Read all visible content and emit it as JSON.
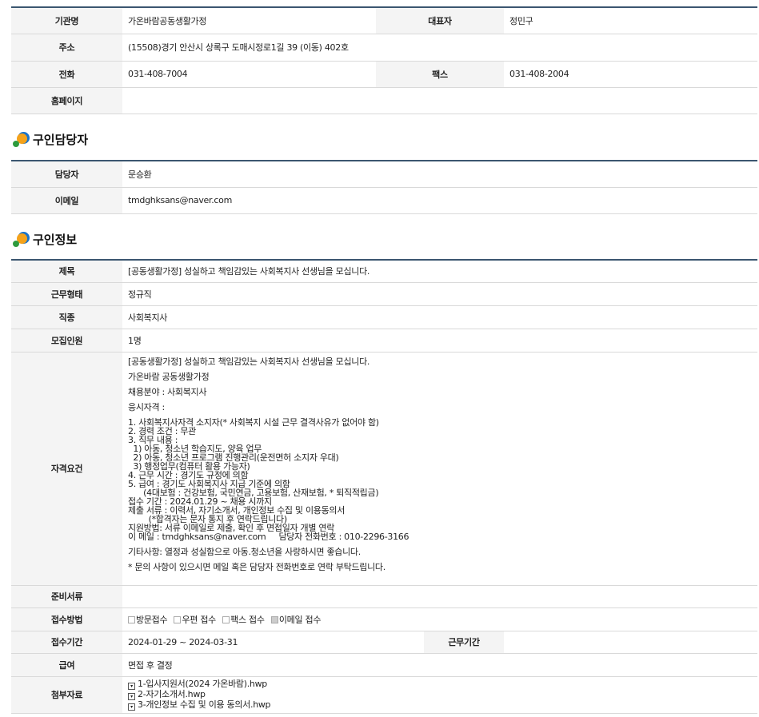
{
  "org": {
    "name_label": "기관명",
    "name": "가온바람공동생활가정",
    "rep_label": "대표자",
    "rep": "정민구",
    "address_label": "주소",
    "address": "(15508)경기 안산시 상록구 도매시정로1길 39 (이동) 402호",
    "phone_label": "전화",
    "phone": "031-408-7004",
    "fax_label": "팩스",
    "fax": "031-408-2004",
    "homepage_label": "홈페이지",
    "homepage": ""
  },
  "contact": {
    "section_title": "구인담당자",
    "manager_label": "담당자",
    "manager": "문승환",
    "email_label": "이메일",
    "email": "tmdghksans@naver.com"
  },
  "job": {
    "section_title": "구인정보",
    "title_label": "제목",
    "title": "[공동생활가정] 성실하고 책임감있는 사회복지사 선생님을 모십니다.",
    "worktype_label": "근무형태",
    "worktype": "정규직",
    "occupation_label": "직종",
    "occupation": "사회복지사",
    "headcount_label": "모집인원",
    "headcount": "1명",
    "qual_label": "자격요건",
    "qual_lines": {
      "l1": "[공동생활가정] 성실하고 책임감있는 사회복지사 선생님을 모십니다.",
      "l2": "가온바람 공동생활가정",
      "l3": "채용분야 : 사회복지사",
      "l4": "응시자격 :",
      "l5": "1. 사회복지사자격 소지자(* 사회복지 시설 근무 결격사유가 없어야 함)",
      "l6": "2. 경력 조건 : 무관",
      "l7": "3. 직무 내용 :",
      "l8": "  1) 아동, 청소년 학습지도, 양육 업무",
      "l9": "  2) 아동, 청소년 프로그램 진행관리(운전면허 소지자 우대)",
      "l10": "  3) 행정업무(컴퓨터 활용 가능자)",
      "l11": "4. 근무 시간 : 경기도 규정에 의함",
      "l12": "5. 급여 : 경기도 사회복지사 지급 기준에 의함",
      "l13": "      (4대보험 : 건강보험, 국민연금, 고용보험, 산재보험, * 퇴직적립금)",
      "l14": "접수 기간 : 2024.01.29 ~ 채용 시까지",
      "l15": "제출 서류 : 이력서, 자기소개서, 개인정보 수집 및 이용동의서",
      "l16": "        (*합격자는 문자 통지 후 연락드립니다)",
      "l17": "지원방법: 서류 이메일로 제출, 확인 후 면접일자 개별 연락",
      "l18": "이 메일 : tmdghksans@naver.com     담당자 전화번호 : 010-2296-3166",
      "l19": "기타사항: 열정과 성실함으로 아동.청소년을 사랑하시면 좋습니다.",
      "l20": "* 문의 사항이 있으시면 메일 혹은 담당자 전화번호로 연락 부탁드립니다."
    },
    "docs_label": "준비서류",
    "docs": "",
    "method_label": "접수방법",
    "methods": [
      {
        "label": "방문접수",
        "checked": false
      },
      {
        "label": "우편 접수",
        "checked": false
      },
      {
        "label": "팩스 접수",
        "checked": false
      },
      {
        "label": "이메일 접수",
        "checked": true
      }
    ],
    "period_label": "접수기간",
    "period": "2024-01-29 ~ 2024-03-31",
    "workperiod_label": "근무기간",
    "workperiod": "",
    "salary_label": "급여",
    "salary": "면접 후 결정",
    "attach_label": "첨부자료",
    "attachments": [
      "1-입사지원서(2024 가온바람).hwp",
      "2-자기소개서.hwp",
      "3-개인정보 수집 및 이용 동의서.hwp"
    ]
  },
  "icons": {
    "section_icon": "colored-dots-icon",
    "file_icon": "file-icon",
    "colors": {
      "blue": "#1a73c9",
      "orange": "#f4a21b",
      "green": "#2e9b3e",
      "header_border": "#3b5670"
    }
  }
}
